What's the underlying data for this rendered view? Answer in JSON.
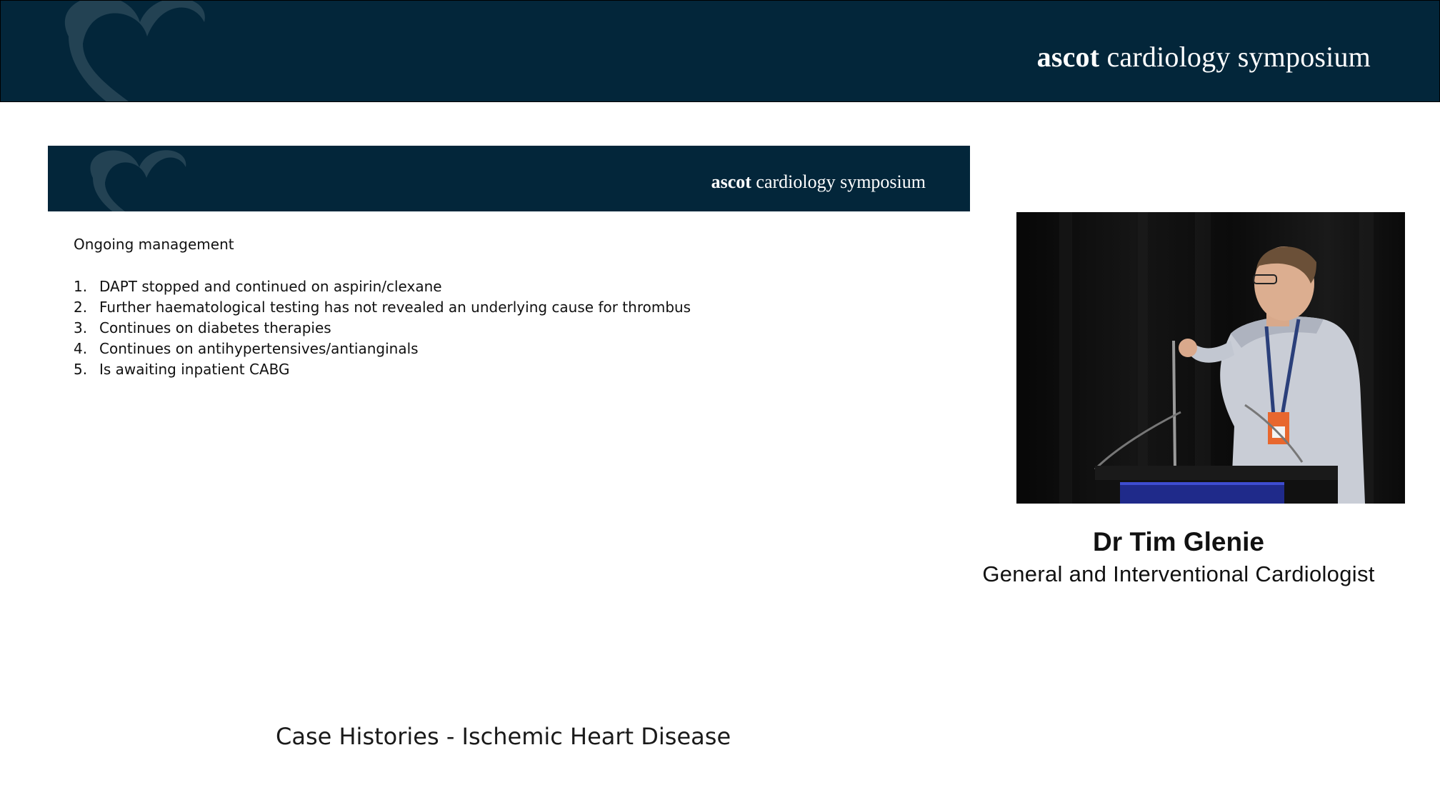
{
  "header": {
    "brand_strong": "ascot",
    "brand_rest": " cardiology symposium"
  },
  "slide": {
    "banner": {
      "brand_strong": "ascot",
      "brand_rest": " cardiology symposium"
    },
    "heading": "Ongoing management",
    "items": [
      {
        "num": "1.",
        "text": "DAPT stopped and continued on aspirin/clexane"
      },
      {
        "num": "2.",
        "text": "Further haematological testing has not revealed an underlying cause for thrombus"
      },
      {
        "num": "3.",
        "text": "Continues on diabetes therapies"
      },
      {
        "num": "4.",
        "text": "Continues on antihypertensives/antianginals"
      },
      {
        "num": "5.",
        "text": "Is awaiting inpatient CABG"
      }
    ]
  },
  "speaker": {
    "name": "Dr Tim Glenie",
    "title": "General and Interventional Cardiologist"
  },
  "session": {
    "title": "Case Histories - Ischemic Heart Disease"
  },
  "colors": {
    "banner": "#03263a",
    "background": "#ffffff",
    "text": "#111111"
  }
}
